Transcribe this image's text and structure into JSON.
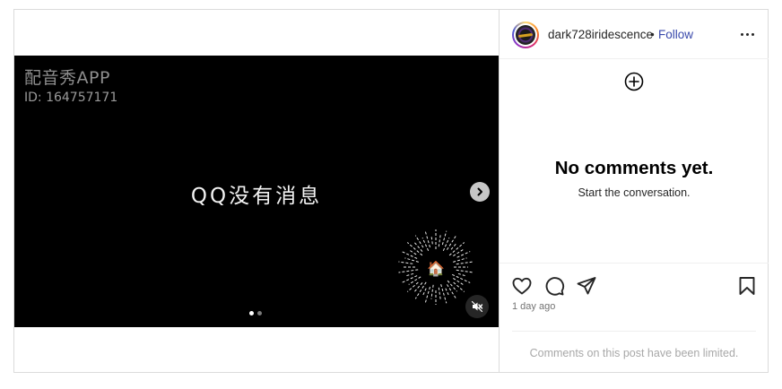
{
  "post": {
    "watermark_brand": "配音秀APP",
    "watermark_id": "ID: 164757171",
    "video_caption": "QQ没有消息",
    "carousel_dot_count": 2,
    "carousel_active_index": 0,
    "center_emoji": "🏠",
    "icons": {
      "next": "chevron-right-icon",
      "mute": "speaker-muted-icon",
      "sticker": "sparkle-burst-icon"
    }
  },
  "header": {
    "username": "dark728iridescence",
    "separator": "•",
    "follow_label": "Follow",
    "more_icon": "more-horizontal-icon"
  },
  "comments": {
    "add_icon": "circle-plus-icon",
    "empty_title": "No comments yet.",
    "empty_subtitle": "Start the conversation."
  },
  "actions": {
    "like_icon": "heart-icon",
    "comment_icon": "comment-bubble-icon",
    "share_icon": "paper-plane-icon",
    "save_icon": "bookmark-icon",
    "timestamp": "1 day ago"
  },
  "footer": {
    "limited_notice": "Comments on this post have been limited."
  },
  "colors": {
    "follow_link": "#3949ab",
    "border": "#dbdbdb",
    "video_bg": "#000000"
  }
}
